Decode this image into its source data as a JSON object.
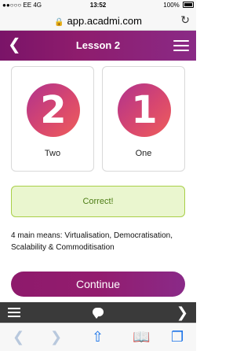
{
  "status": {
    "carrier": "EE",
    "network": "4G",
    "time": "13:52",
    "battery": "100%"
  },
  "browser": {
    "url": "app.acadmi.com"
  },
  "header": {
    "title": "Lesson 2"
  },
  "cards": [
    {
      "number": "2",
      "label": "Two"
    },
    {
      "number": "1",
      "label": "One"
    }
  ],
  "feedback": {
    "text": "Correct!"
  },
  "explanation": "4 main means: Virtualisation, Democratisation, Scalability & Commoditisation",
  "continue_button": "Continue",
  "colors": {
    "brand_purple": "#8e1a6c",
    "correct_bg": "#eaf6cf",
    "correct_border": "#a9cf48",
    "correct_text": "#4d7d15"
  }
}
